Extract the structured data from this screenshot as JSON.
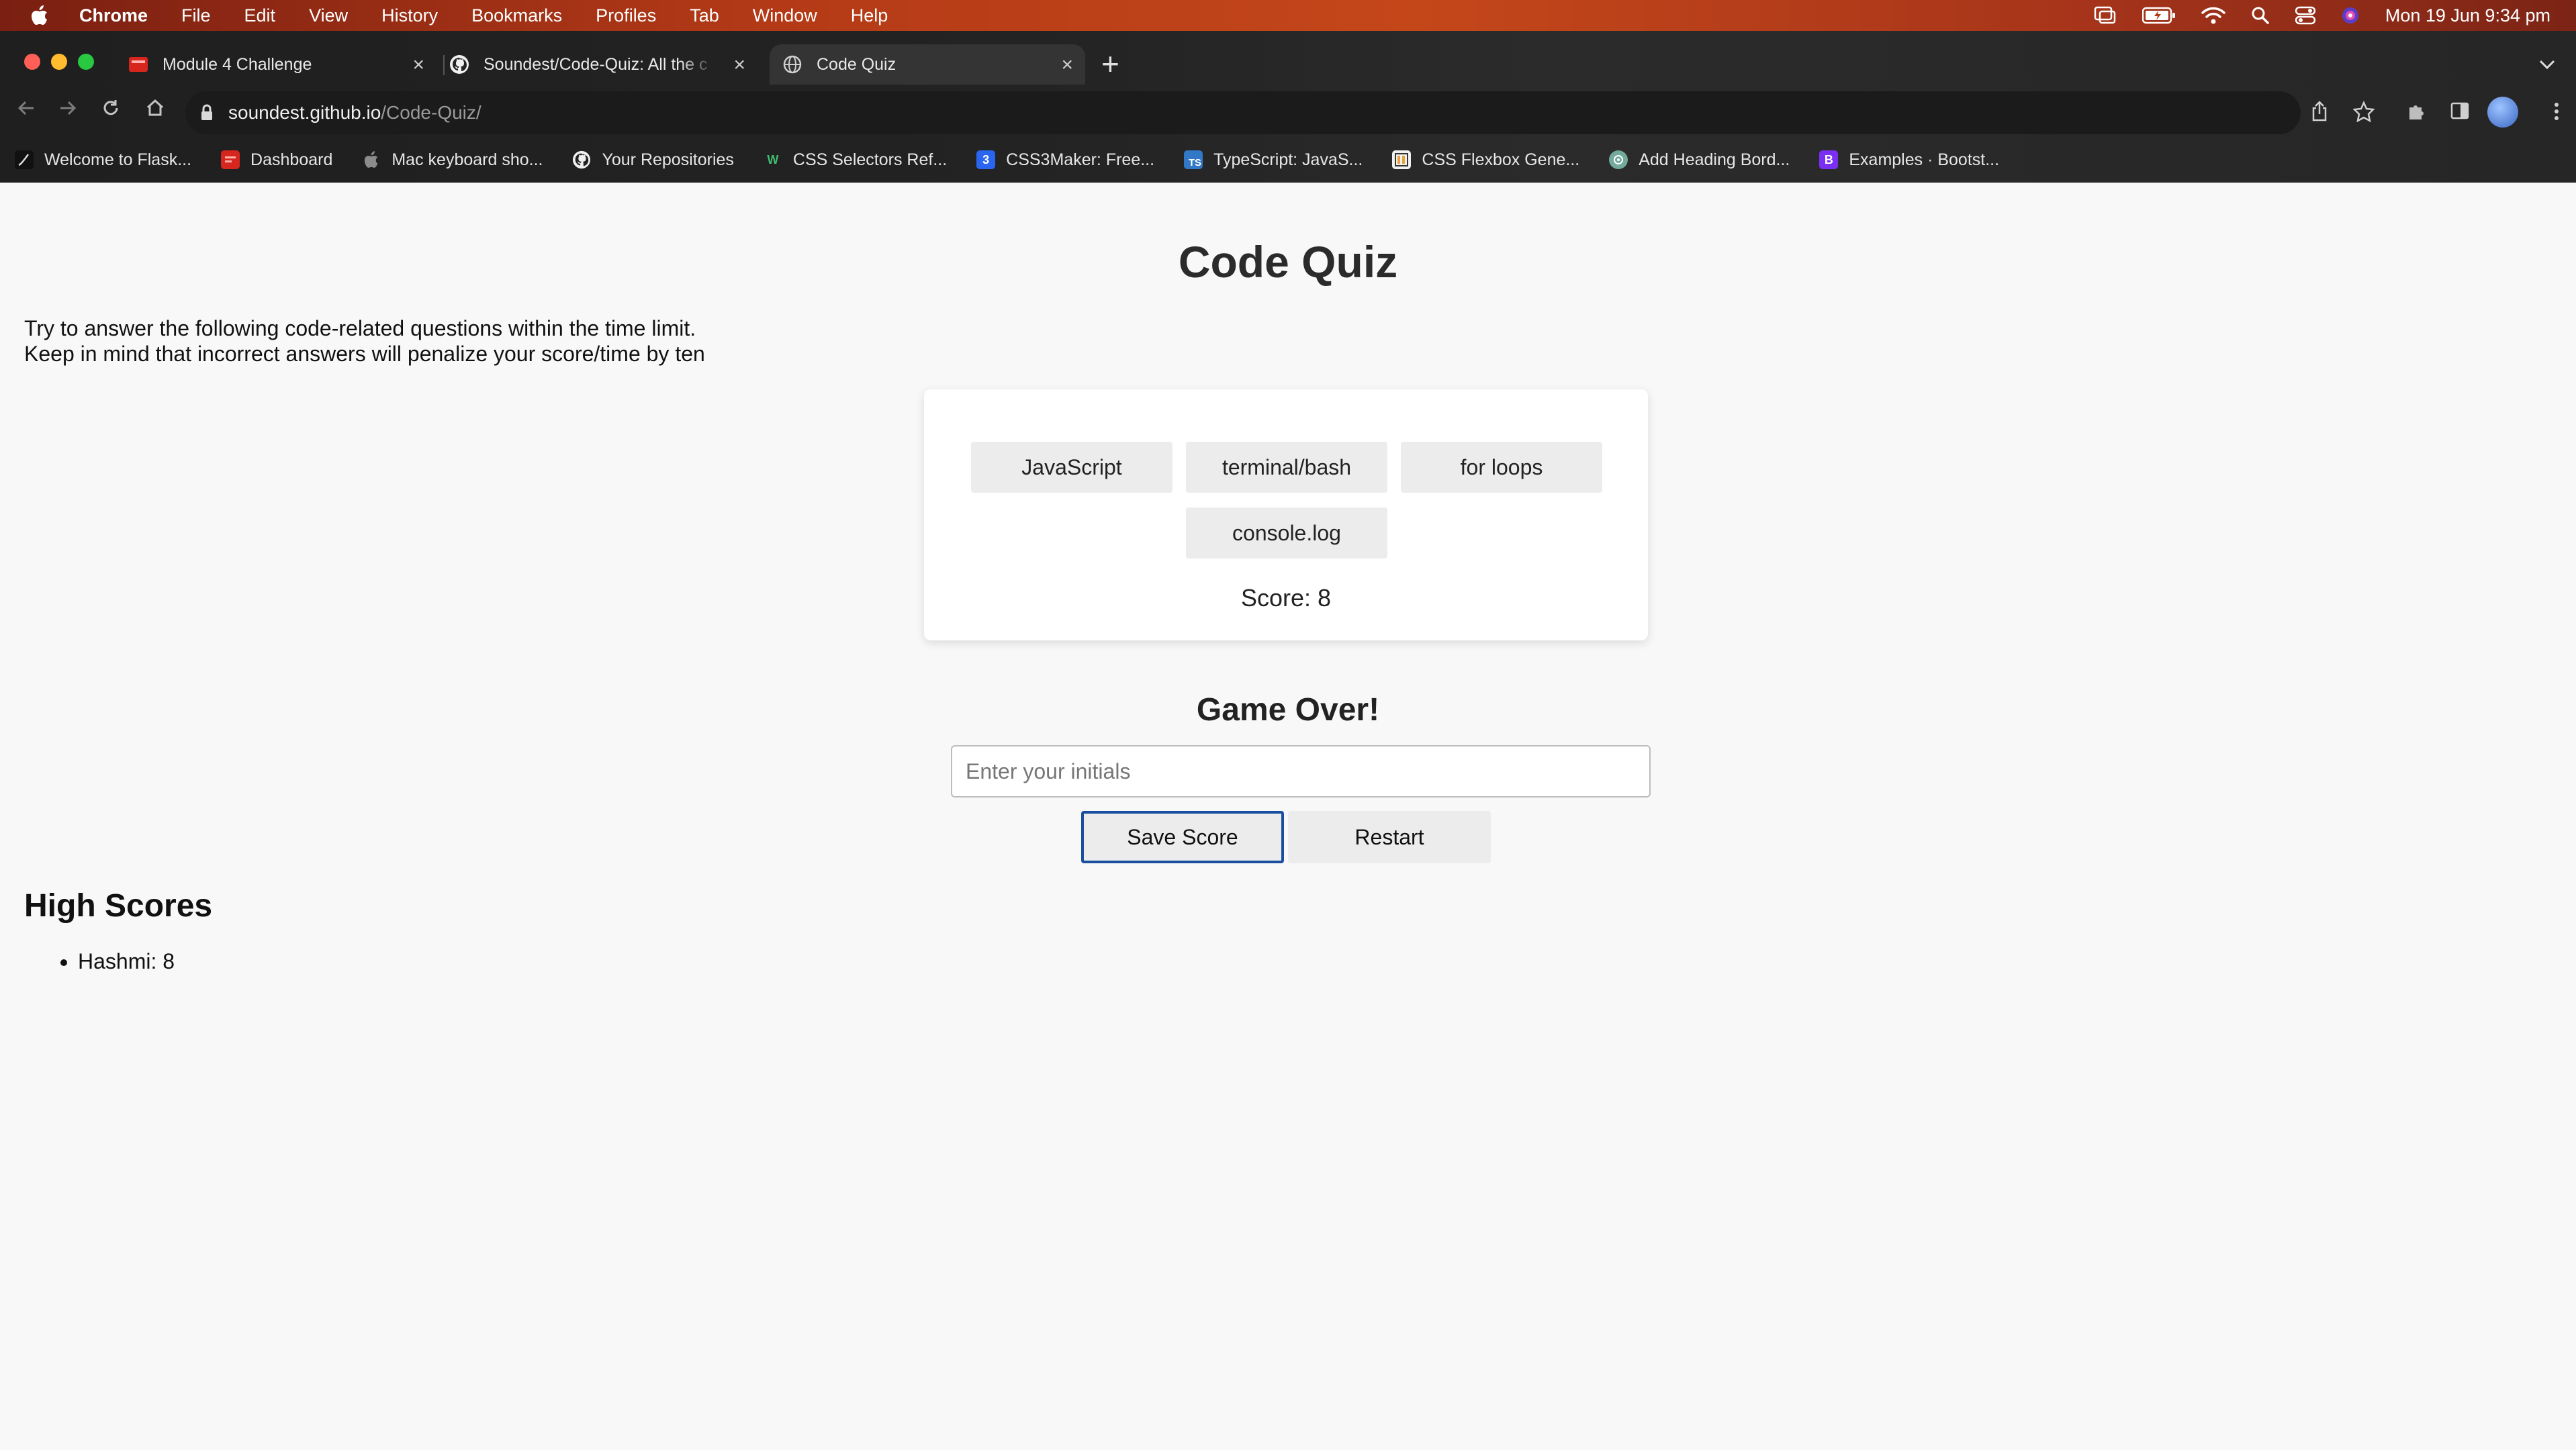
{
  "menubar": {
    "app": "Chrome",
    "items": [
      "File",
      "Edit",
      "View",
      "History",
      "Bookmarks",
      "Profiles",
      "Tab",
      "Window",
      "Help"
    ],
    "clock": "Mon 19 Jun  9:34 pm"
  },
  "tabs": [
    {
      "title": "Module 4 Challenge",
      "icon": "red-app-icon"
    },
    {
      "title": "Soundest/Code-Quiz: All the c",
      "icon": "github-icon"
    },
    {
      "title": "Code Quiz",
      "icon": "globe-icon",
      "active": true
    }
  ],
  "address": {
    "domain": "soundest.github.io",
    "path": "/Code-Quiz/"
  },
  "bookmarks": [
    {
      "label": "Welcome to Flask...",
      "icon": "flask-icon"
    },
    {
      "label": "Dashboard",
      "icon": "dashboard-icon"
    },
    {
      "label": "Mac keyboard sho...",
      "icon": "apple-icon"
    },
    {
      "label": "Your Repositories",
      "icon": "github-icon"
    },
    {
      "label": "CSS Selectors Ref...",
      "icon": "w-icon"
    },
    {
      "label": "CSS3Maker: Free...",
      "icon": "css3-icon"
    },
    {
      "label": "TypeScript: JavaS...",
      "icon": "ts-icon"
    },
    {
      "label": "CSS Flexbox Gene...",
      "icon": "flexbox-icon"
    },
    {
      "label": "Add Heading Bord...",
      "icon": "chatgpt-icon"
    },
    {
      "label": "Examples · Bootst...",
      "icon": "bootstrap-icon"
    }
  ],
  "page": {
    "title": "Code Quiz",
    "intro_line1": "Try to answer the following code-related questions within the time limit.",
    "intro_line2": "Keep in mind that incorrect answers will penalize your score/time by ten",
    "choices": [
      "JavaScript",
      "terminal/bash",
      "for loops",
      "console.log"
    ],
    "score": "Score: 8",
    "game_over": "Game Over!",
    "initials_placeholder": "Enter your initials",
    "initials_value": "",
    "save_label": "Save Score",
    "restart_label": "Restart",
    "high_scores_title": "High Scores",
    "high_scores": [
      "Hashmi: 8"
    ]
  },
  "colors": {
    "menubar": "#b43a17",
    "chrome_frame": "#232323",
    "page_bg": "#f8f8f8",
    "button_bg": "#ececec",
    "focus_border": "#1a4fa0"
  }
}
